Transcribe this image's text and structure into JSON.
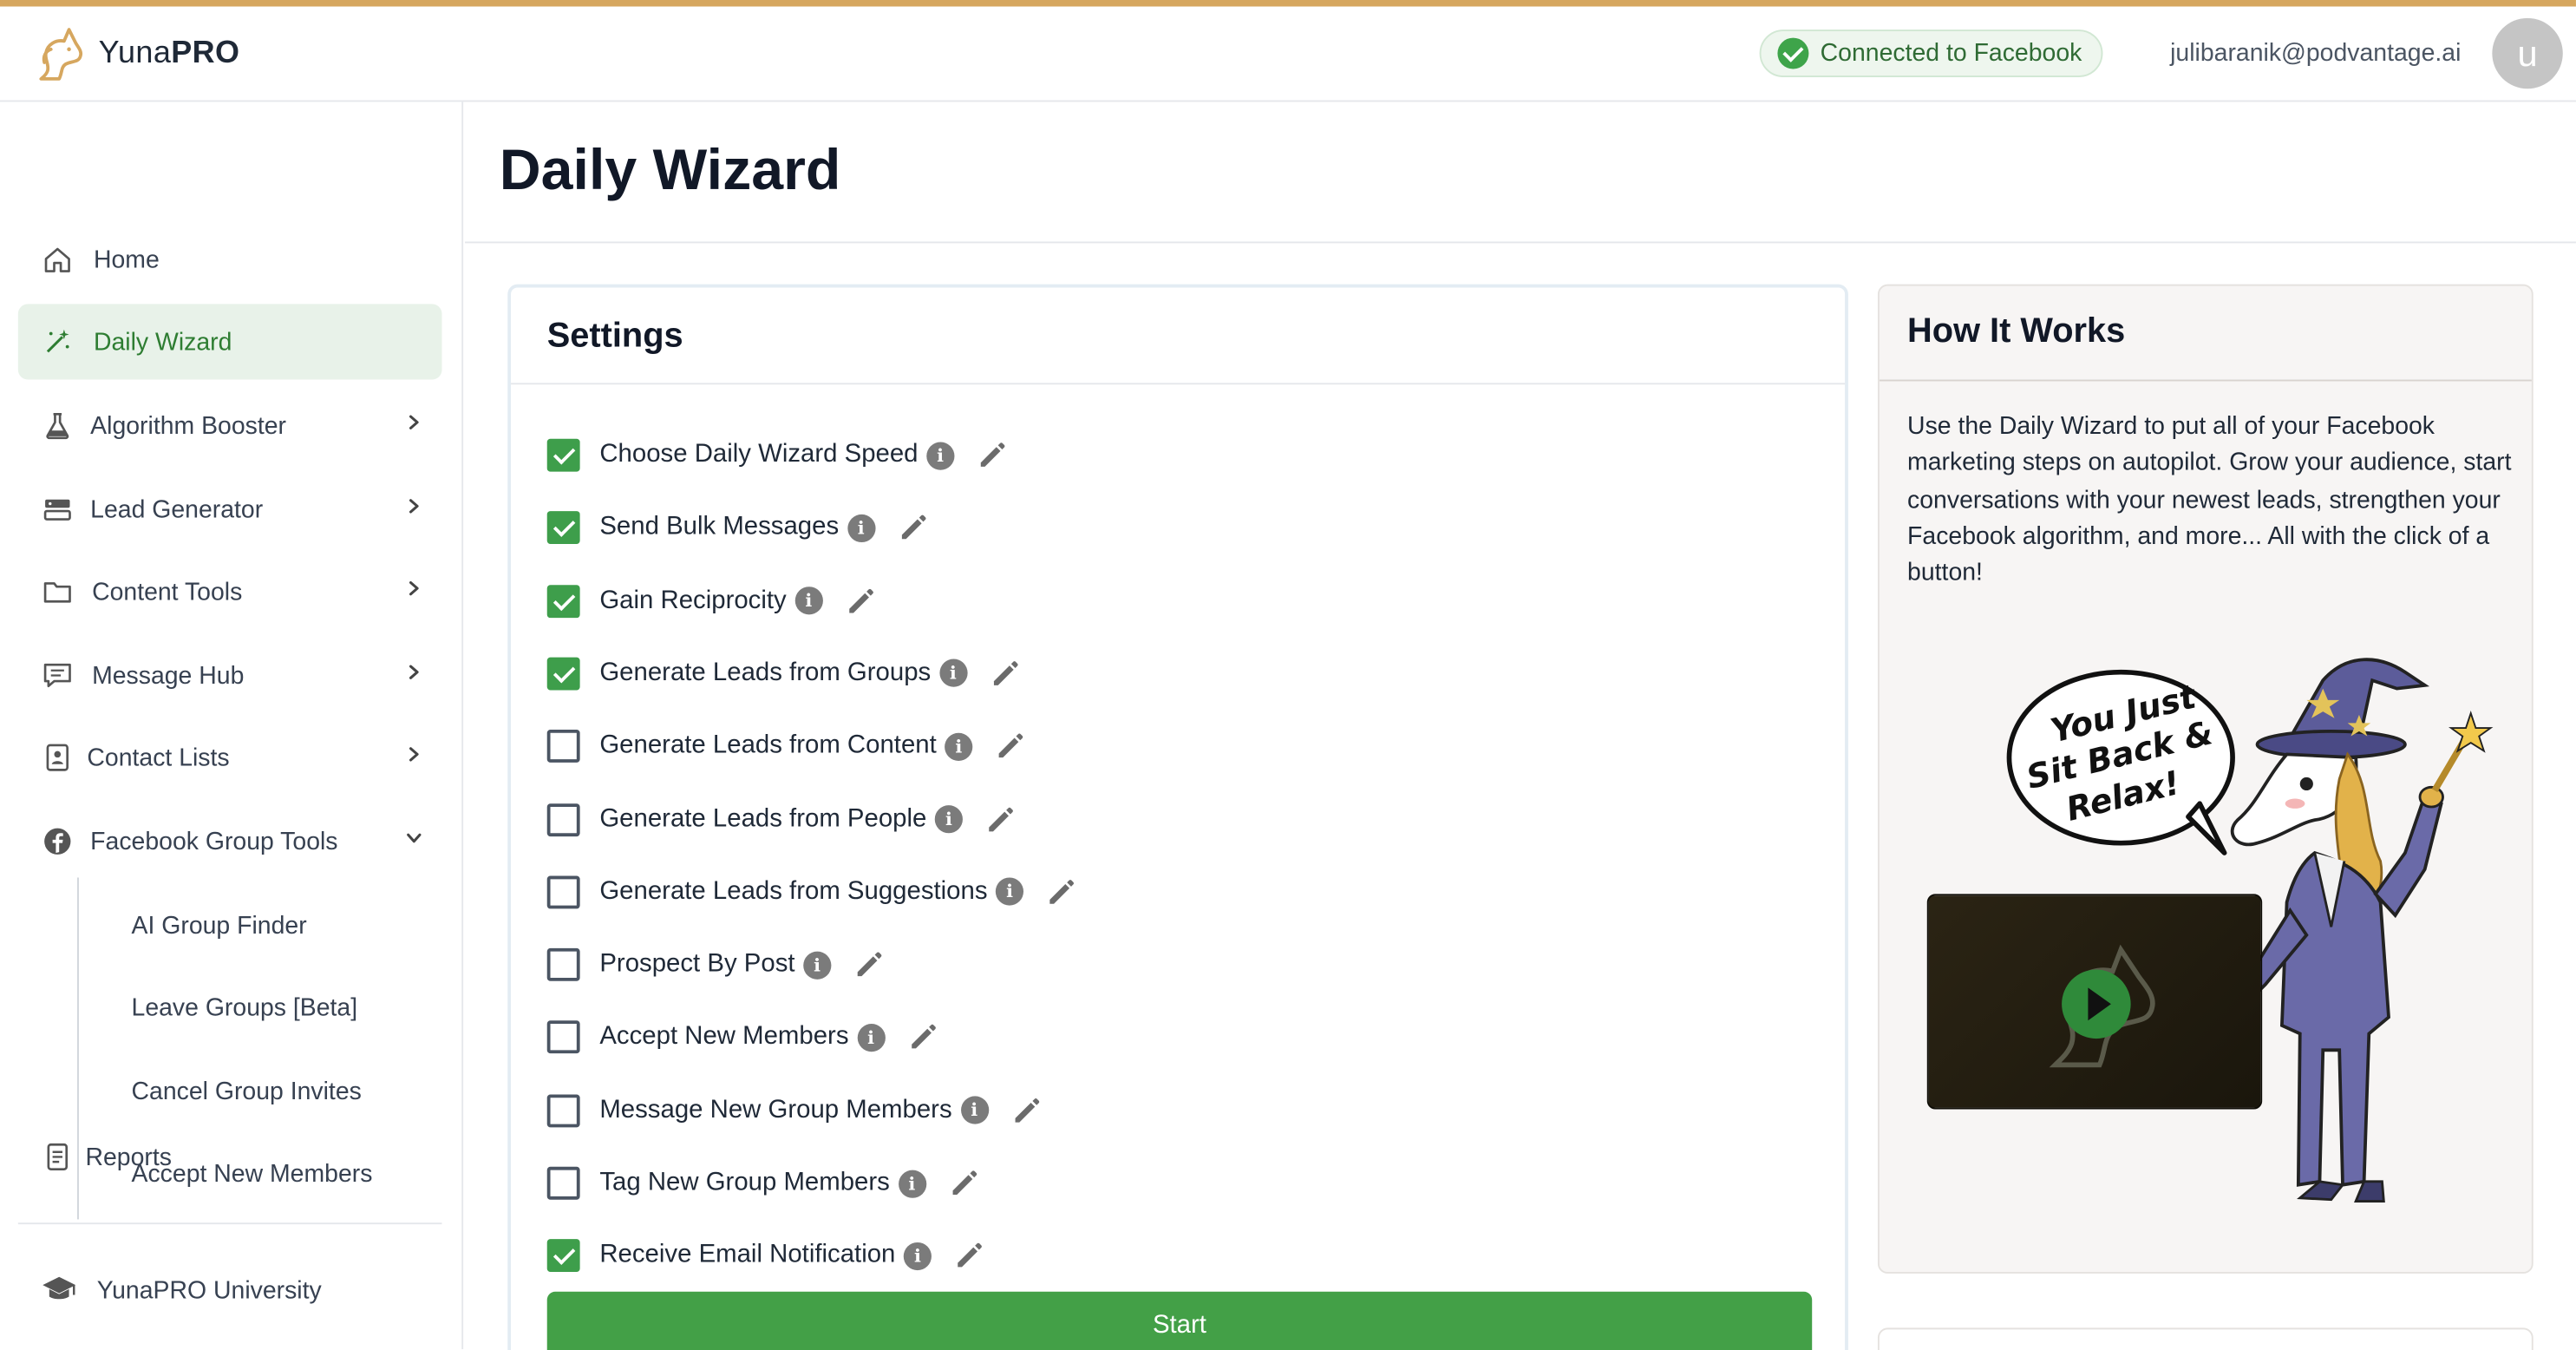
{
  "header": {
    "brand_light": "Yuna",
    "brand_bold": "PRO",
    "fb_status": "Connected to Facebook",
    "email": "julibaranik@podvantage.ai",
    "avatar_letter": "u"
  },
  "sidebar": {
    "items": [
      {
        "label": "Home",
        "icon": "home-icon",
        "active": false,
        "chevron": "none"
      },
      {
        "label": "Daily Wizard",
        "icon": "magic-wand-icon",
        "active": true,
        "chevron": "none"
      },
      {
        "label": "Algorithm Booster",
        "icon": "flask-icon",
        "active": false,
        "chevron": "right"
      },
      {
        "label": "Lead Generator",
        "icon": "database-icon",
        "active": false,
        "chevron": "right"
      },
      {
        "label": "Content Tools",
        "icon": "folder-icon",
        "active": false,
        "chevron": "right"
      },
      {
        "label": "Message Hub",
        "icon": "chat-icon",
        "active": false,
        "chevron": "right"
      },
      {
        "label": "Contact Lists",
        "icon": "contacts-icon",
        "active": false,
        "chevron": "right"
      },
      {
        "label": "Facebook Group Tools",
        "icon": "facebook-icon",
        "active": false,
        "chevron": "down"
      }
    ],
    "sub_items": [
      "AI Group Finder",
      "Leave Groups [Beta]",
      "Cancel Group Invites",
      "Accept New Members"
    ],
    "reports": "Reports",
    "university": "YunaPRO University"
  },
  "main": {
    "title": "Daily Wizard"
  },
  "settings": {
    "title": "Settings",
    "options": [
      {
        "label": "Choose Daily Wizard Speed",
        "checked": true
      },
      {
        "label": "Send Bulk Messages",
        "checked": true
      },
      {
        "label": "Gain Reciprocity",
        "checked": true
      },
      {
        "label": "Generate Leads from Groups",
        "checked": true
      },
      {
        "label": "Generate Leads from Content",
        "checked": false
      },
      {
        "label": "Generate Leads from People",
        "checked": false
      },
      {
        "label": "Generate Leads from Suggestions",
        "checked": false
      },
      {
        "label": "Prospect By Post",
        "checked": false
      },
      {
        "label": "Accept New Members",
        "checked": false
      },
      {
        "label": "Message New Group Members",
        "checked": false
      },
      {
        "label": "Tag New Group Members",
        "checked": false
      },
      {
        "label": "Receive Email Notification",
        "checked": true
      }
    ],
    "start_label": "Start"
  },
  "how_it_works": {
    "title": "How It Works",
    "text": "Use the Daily Wizard to put all of your Facebook marketing steps on autopilot. Grow your audience, start conversations with your newest leads, strengthen your Facebook algorithm, and more... All with the click of a button!",
    "bubble_line1": "You Just",
    "bubble_line2": "Sit Back &",
    "bubble_line3": "Relax!"
  },
  "colors": {
    "accent_green": "#43a047",
    "active_bg": "#e8f2e9",
    "top_bar": "#d6a75f"
  }
}
